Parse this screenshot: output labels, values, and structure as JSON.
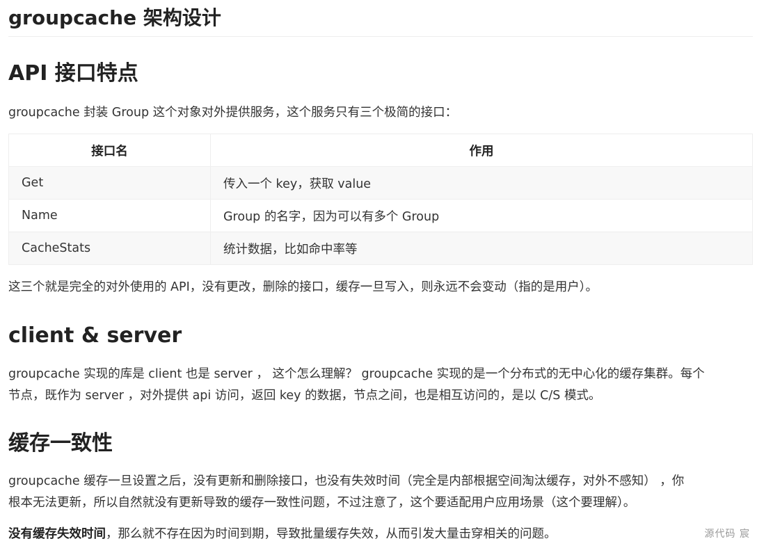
{
  "title": "groupcache 架构设计",
  "sections": {
    "api": {
      "heading": "API 接口特点",
      "intro": "groupcache 封装 Group 这个对象对外提供服务，这个服务只有三个极简的接口：",
      "table": {
        "headers": [
          "接口名",
          "作用"
        ],
        "rows": [
          [
            "Get",
            "传入一个 key，获取 value"
          ],
          [
            "Name",
            "Group 的名字，因为可以有多个 Group"
          ],
          [
            "CacheStats",
            "统计数据，比如命中率等"
          ]
        ]
      },
      "outro": "这三个就是完全的对外使用的 API，没有更改，删除的接口，缓存一旦写入，则永远不会变动（指的是用户）。"
    },
    "client_server": {
      "heading": "client & server",
      "line1": "groupcache 实现的库是 client 也是 server ， 这个怎么理解？ groupcache 实现的是一个分布式的无中心化的缓存集群。每个",
      "line2": "节点，既作为 server ，对外提供 api 访问，返回 key 的数据，节点之间，也是相互访问的，是以 C/S 模式。"
    },
    "consistency": {
      "heading": "缓存一致性",
      "line1": "groupcache 缓存一旦设置之后，没有更新和删除接口，也没有失效时间（完全是内部根据空间淘汰缓存，对外不感知） ，你",
      "line2": "根本无法更新，所以自然就没有更新导致的缓存一致性问题，不过注意了，这个要适配用户应用场景（这个要理解）。",
      "bold_lead": "没有缓存失效时间",
      "rest": "，那么就不存在因为时间到期，导致批量缓存失效，从而引发大量击穿相关的问题。"
    }
  },
  "watermark": "源代码  宸"
}
